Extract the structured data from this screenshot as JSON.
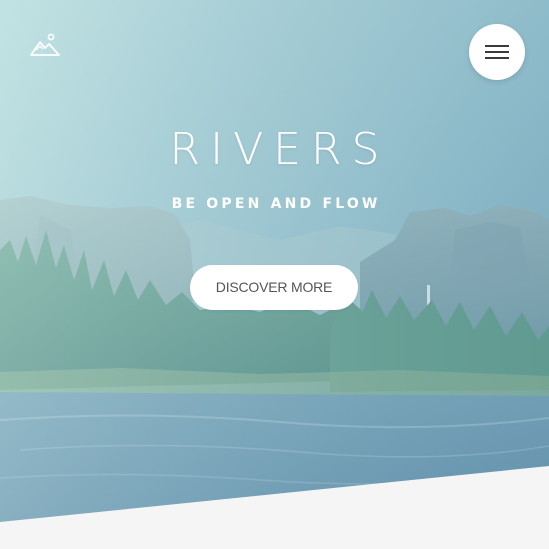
{
  "hero": {
    "title": "RIVERS",
    "subtitle": "BE OPEN AND FLOW",
    "cta_label": "DISCOVER MORE"
  },
  "header": {
    "logo_icon": "mountain-logo-icon",
    "menu_icon": "hamburger-menu-icon"
  },
  "colors": {
    "overlay": "#8fc4cc",
    "button_bg": "#ffffff",
    "button_text": "#555555",
    "footer_bg": "#f5f5f6"
  }
}
